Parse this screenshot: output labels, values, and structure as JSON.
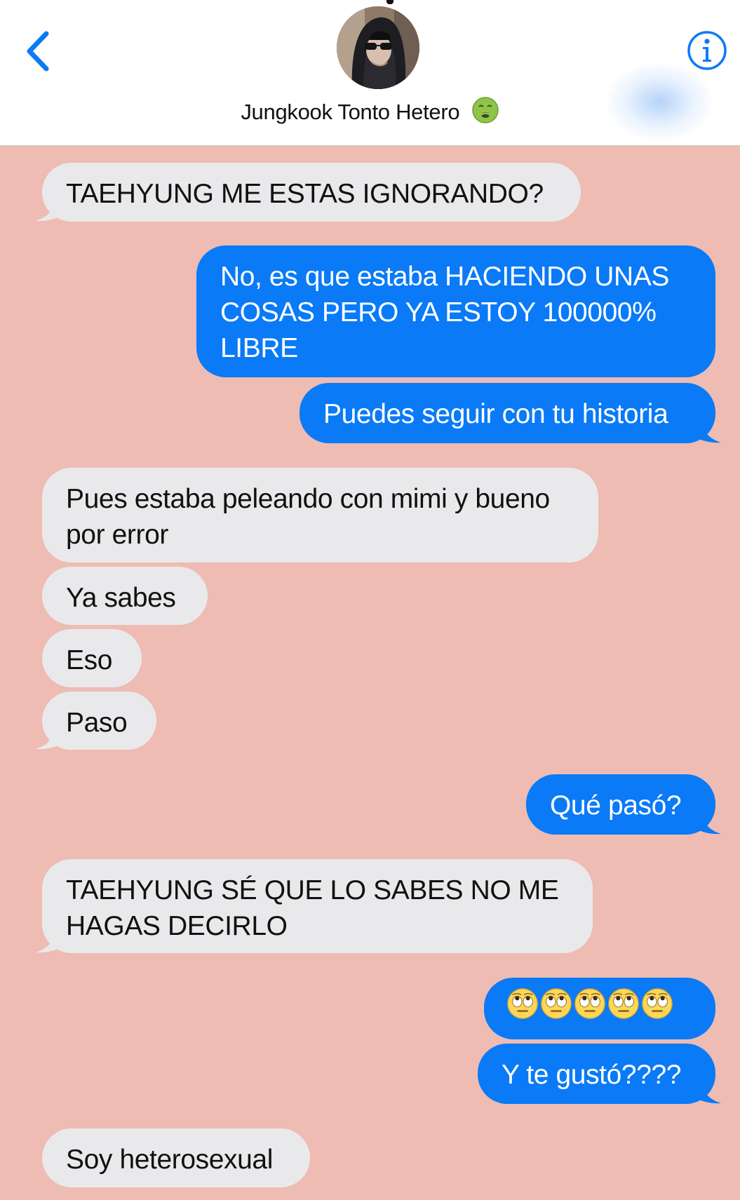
{
  "header": {
    "contact_name": "Jungkook Tonto Hetero",
    "name_emoji": "nauseated-face",
    "back_icon": "chevron-left-icon",
    "info_icon": "info-icon",
    "accent_color": "#0a7af7"
  },
  "colors": {
    "background": "#eebcb2",
    "incoming_bubble": "#e9e9eb",
    "outgoing_bubble": "#0a7af7"
  },
  "messages": [
    {
      "direction": "incoming",
      "text": "TAEHYUNG ME ESTAS IGNORANDO?"
    },
    {
      "direction": "outgoing",
      "lines": [
        "No, es que estaba HACIENDO UNAS",
        "COSAS PERO YA ESTOY 100000%",
        "LIBRE"
      ]
    },
    {
      "direction": "outgoing",
      "text": "Puedes seguir con tu historia"
    },
    {
      "direction": "incoming",
      "lines": [
        "Pues estaba peleando con mimi y bueno",
        "por error"
      ]
    },
    {
      "direction": "incoming",
      "text": "Ya sabes"
    },
    {
      "direction": "incoming",
      "text": "Eso"
    },
    {
      "direction": "incoming",
      "text": "Paso"
    },
    {
      "direction": "outgoing",
      "text": "Qué pasó?"
    },
    {
      "direction": "incoming",
      "lines": [
        "TAEHYUNG SÉ QUE LO SABES NO ME",
        "HAGAS DECIRLO"
      ]
    },
    {
      "direction": "outgoing",
      "emoji": "face-with-rolling-eyes",
      "emoji_count": 5
    },
    {
      "direction": "outgoing",
      "text": "Y te gustó????"
    },
    {
      "direction": "incoming",
      "text": "Soy heterosexual"
    }
  ]
}
